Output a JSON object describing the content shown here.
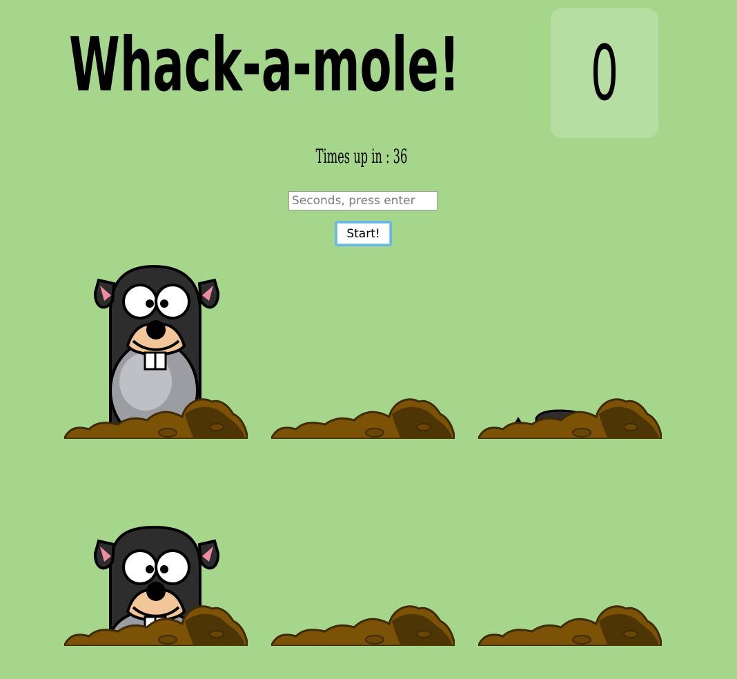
{
  "game": {
    "title": "Whack-a-mole!",
    "score": "0",
    "timer_label": "Times up in : 36"
  },
  "controls": {
    "seconds_placeholder": "Seconds, press enter",
    "start_label": "Start!"
  },
  "holes": [
    {
      "mole": "up"
    },
    {
      "mole": "hidden"
    },
    {
      "mole": "peeking"
    },
    {
      "mole": "up"
    },
    {
      "mole": "hidden"
    },
    {
      "mole": "hidden"
    }
  ],
  "colors": {
    "background": "#a5d68b",
    "dirt": "#7b5206",
    "dirt_dark": "#3e2b06",
    "mole_body": "#2d2d2d",
    "mole_belly": "#9c9ca3",
    "mole_face": "#f3c69a",
    "ear_inner": "#ee8ba0",
    "button_focus": "#68b7e4"
  }
}
